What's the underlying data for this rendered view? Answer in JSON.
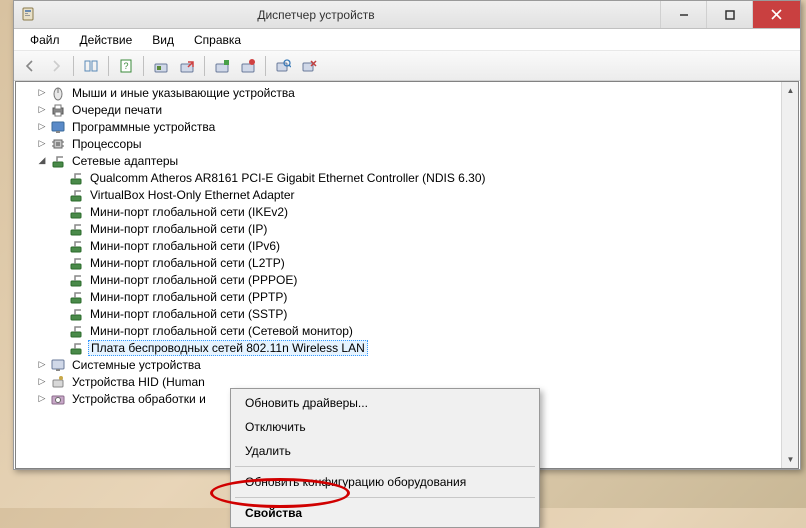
{
  "window": {
    "title": "Диспетчер устройств"
  },
  "menubar": {
    "file": "Файл",
    "action": "Действие",
    "view": "Вид",
    "help": "Справка"
  },
  "tree": {
    "items": [
      {
        "level": 1,
        "expand": "▷",
        "icon": "mouse",
        "label": "Мыши и иные указывающие устройства"
      },
      {
        "level": 1,
        "expand": "▷",
        "icon": "printer",
        "label": "Очереди печати"
      },
      {
        "level": 1,
        "expand": "▷",
        "icon": "software",
        "label": "Программные устройства"
      },
      {
        "level": 1,
        "expand": "▷",
        "icon": "cpu",
        "label": "Процессоры"
      },
      {
        "level": 1,
        "expand": "◢",
        "icon": "network",
        "label": "Сетевые адаптеры"
      },
      {
        "level": 2,
        "expand": "",
        "icon": "adapter",
        "label": "Qualcomm Atheros AR8161 PCI-E Gigabit Ethernet Controller (NDIS 6.30)"
      },
      {
        "level": 2,
        "expand": "",
        "icon": "adapter",
        "label": "VirtualBox Host-Only Ethernet Adapter"
      },
      {
        "level": 2,
        "expand": "",
        "icon": "adapter",
        "label": "Мини-порт глобальной сети (IKEv2)"
      },
      {
        "level": 2,
        "expand": "",
        "icon": "adapter",
        "label": "Мини-порт глобальной сети (IP)"
      },
      {
        "level": 2,
        "expand": "",
        "icon": "adapter",
        "label": "Мини-порт глобальной сети (IPv6)"
      },
      {
        "level": 2,
        "expand": "",
        "icon": "adapter",
        "label": "Мини-порт глобальной сети (L2TP)"
      },
      {
        "level": 2,
        "expand": "",
        "icon": "adapter",
        "label": "Мини-порт глобальной сети (PPPOE)"
      },
      {
        "level": 2,
        "expand": "",
        "icon": "adapter",
        "label": "Мини-порт глобальной сети (PPTP)"
      },
      {
        "level": 2,
        "expand": "",
        "icon": "adapter",
        "label": "Мини-порт глобальной сети (SSTP)"
      },
      {
        "level": 2,
        "expand": "",
        "icon": "adapter",
        "label": "Мини-порт глобальной сети (Сетевой монитор)"
      },
      {
        "level": 2,
        "expand": "",
        "icon": "adapter",
        "label": "Плата беспроводных сетей 802.11n Wireless LAN",
        "selected": true
      },
      {
        "level": 1,
        "expand": "▷",
        "icon": "system",
        "label": "Системные устройства"
      },
      {
        "level": 1,
        "expand": "▷",
        "icon": "hid",
        "label": "Устройства HID (Human"
      },
      {
        "level": 1,
        "expand": "▷",
        "icon": "imaging",
        "label": "Устройства обработки и"
      }
    ]
  },
  "context_menu": {
    "update_drivers": "Обновить драйверы...",
    "disable": "Отключить",
    "uninstall": "Удалить",
    "scan_hardware": "Обновить конфигурацию оборудования",
    "properties": "Свойства"
  }
}
